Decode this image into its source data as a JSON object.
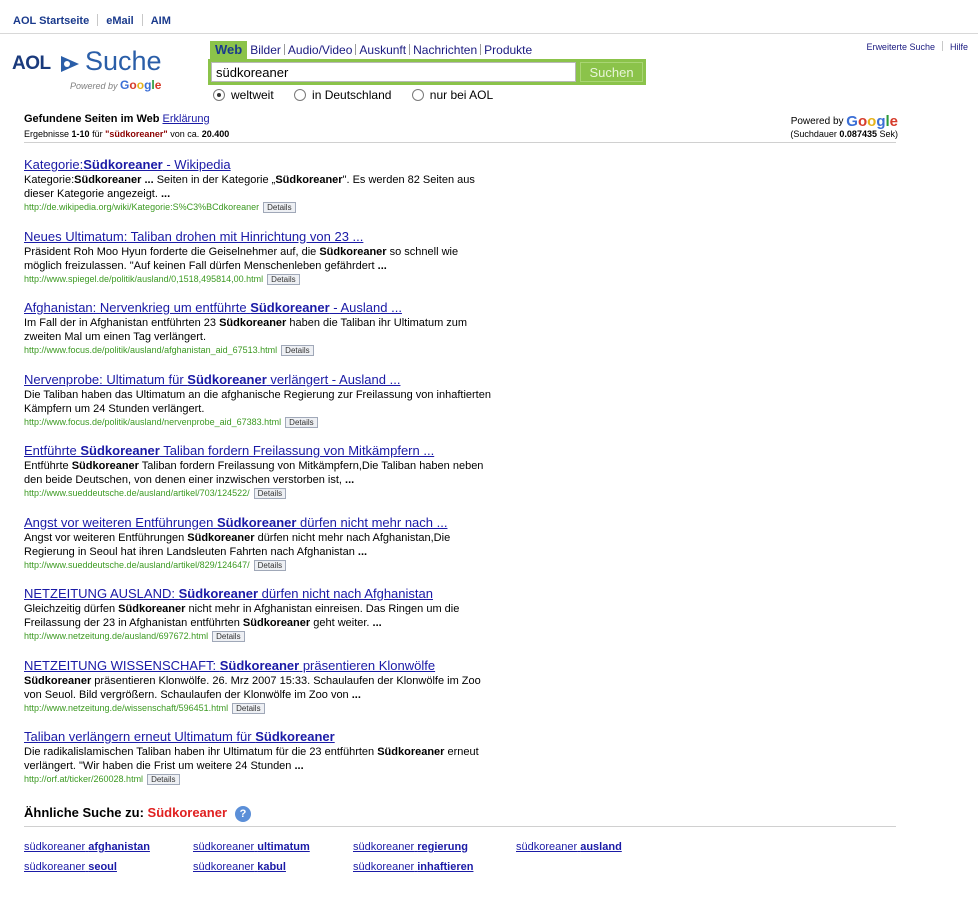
{
  "topnav": {
    "home": "AOL Startseite",
    "email": "eMail",
    "aim": "AIM"
  },
  "logo": {
    "aol": "AOL",
    "suche": "Suche",
    "powered": "Powered by",
    "google": "Google"
  },
  "tabs": [
    "Web",
    "Bilder",
    "Audio/Video",
    "Auskunft",
    "Nachrichten",
    "Produkte"
  ],
  "search": {
    "query": "südkoreaner",
    "button": "Suchen"
  },
  "scope": [
    "weltweit",
    "in Deutschland",
    "nur bei AOL"
  ],
  "toplinks": {
    "advanced": "Erweiterte Suche",
    "help": "Hilfe"
  },
  "summary": {
    "found": "Gefundene Seiten im Web",
    "explain": "Erklärung",
    "results_prefix": "Ergebnisse",
    "range": "1-10",
    "for": "für",
    "term": "\"südkoreaner\"",
    "about": "von ca.",
    "total": "20.400",
    "powered": "Powered by",
    "google": "Google",
    "duration_prefix": "(Suchdauer",
    "duration": "0.087435",
    "duration_suffix": "Sek)"
  },
  "details_label": "Details",
  "results": [
    {
      "title": [
        [
          "Kategorie:",
          false
        ],
        [
          "Südkoreaner",
          true
        ],
        [
          " - Wikipedia",
          false
        ]
      ],
      "snippet": [
        [
          "Kategorie:",
          false
        ],
        [
          "Südkoreaner ...",
          true
        ],
        [
          " Seiten in der Kategorie „",
          false
        ],
        [
          "Südkoreaner",
          true
        ],
        [
          "\". Es werden 82 Seiten aus dieser Kategorie angezeigt. ",
          false
        ],
        [
          "...",
          true
        ]
      ],
      "url": "http://de.wikipedia.org/wiki/Kategorie:S%C3%BCdkoreaner"
    },
    {
      "title": [
        [
          "Neues Ultimatum: Taliban drohen mit Hinrichtung von 23 ...",
          false
        ]
      ],
      "snippet": [
        [
          "Präsident Roh Moo Hyun forderte die Geiselnehmer auf, die ",
          false
        ],
        [
          "Südkoreaner",
          true
        ],
        [
          " so schnell wie möglich freizulassen. \"Auf keinen Fall dürfen Menschenleben gefährdert ",
          false
        ],
        [
          "...",
          true
        ]
      ],
      "url": "http://www.spiegel.de/politik/ausland/0,1518,495814,00.html"
    },
    {
      "title": [
        [
          "Afghanistan: Nervenkrieg um entführte ",
          false
        ],
        [
          "Südkoreaner",
          true
        ],
        [
          " - Ausland ...",
          false
        ]
      ],
      "snippet": [
        [
          "Im Fall der in Afghanistan entführten 23 ",
          false
        ],
        [
          "Südkoreaner",
          true
        ],
        [
          " haben die Taliban ihr Ultimatum zum zweiten Mal um einen Tag verlängert.",
          false
        ]
      ],
      "url": "http://www.focus.de/politik/ausland/afghanistan_aid_67513.html"
    },
    {
      "title": [
        [
          "Nervenprobe: Ultimatum für ",
          false
        ],
        [
          "Südkoreaner",
          true
        ],
        [
          " verlängert - Ausland ...",
          false
        ]
      ],
      "snippet": [
        [
          "Die Taliban haben das Ultimatum an die afghanische Regierung zur Freilassung von inhaftierten Kämpfern um 24 Stunden verlängert.",
          false
        ]
      ],
      "url": "http://www.focus.de/politik/ausland/nervenprobe_aid_67383.html"
    },
    {
      "title": [
        [
          "Entführte ",
          false
        ],
        [
          "Südkoreaner",
          true
        ],
        [
          " Taliban fordern Freilassung von Mitkämpfern ...",
          false
        ]
      ],
      "snippet": [
        [
          "Entführte ",
          false
        ],
        [
          "Südkoreaner",
          true
        ],
        [
          " Taliban fordern Freilassung von Mitkämpfern,Die Taliban haben neben den beide Deutschen, von denen einer inzwischen verstorben ist, ",
          false
        ],
        [
          "...",
          true
        ]
      ],
      "url": "http://www.sueddeutsche.de/ausland/artikel/703/124522/"
    },
    {
      "title": [
        [
          "Angst vor weiteren Entführungen ",
          false
        ],
        [
          "Südkoreaner",
          true
        ],
        [
          " dürfen nicht mehr nach ...",
          false
        ]
      ],
      "snippet": [
        [
          "Angst vor weiteren Entführungen ",
          false
        ],
        [
          "Südkoreaner",
          true
        ],
        [
          " dürfen nicht mehr nach Afghanistan,Die Regierung in Seoul hat ihren Landsleuten Fahrten nach Afghanistan ",
          false
        ],
        [
          "...",
          true
        ]
      ],
      "url": "http://www.sueddeutsche.de/ausland/artikel/829/124647/"
    },
    {
      "title": [
        [
          "NETZEITUNG AUSLAND: ",
          false
        ],
        [
          "Südkoreaner",
          true
        ],
        [
          " dürfen nicht nach Afghanistan",
          false
        ]
      ],
      "snippet": [
        [
          "Gleichzeitig dürfen ",
          false
        ],
        [
          "Südkoreaner",
          true
        ],
        [
          " nicht mehr in Afghanistan einreisen. Das Ringen um die Freilassung der 23 in Afghanistan entführten ",
          false
        ],
        [
          "Südkoreaner",
          true
        ],
        [
          " geht weiter. ",
          false
        ],
        [
          "...",
          true
        ]
      ],
      "url": "http://www.netzeitung.de/ausland/697672.html"
    },
    {
      "title": [
        [
          "NETZEITUNG WISSENSCHAFT: ",
          false
        ],
        [
          "Südkoreaner",
          true
        ],
        [
          " präsentieren Klonwölfe",
          false
        ]
      ],
      "snippet": [
        [
          "Südkoreaner",
          true
        ],
        [
          " präsentieren Klonwölfe. 26. Mrz 2007 15:33. Schaulaufen der Klonwölfe im Zoo von Seuol. Bild vergrößern. Schaulaufen der Klonwölfe im Zoo von ",
          false
        ],
        [
          "...",
          true
        ]
      ],
      "url": "http://www.netzeitung.de/wissenschaft/596451.html"
    },
    {
      "title": [
        [
          "Taliban verlängern erneut Ultimatum für ",
          false
        ],
        [
          "Südkoreaner",
          true
        ]
      ],
      "snippet": [
        [
          "Die radikalislamischen Taliban haben ihr Ultimatum für die 23 entführten ",
          false
        ],
        [
          "Südkoreaner",
          true
        ],
        [
          " erneut verlängert. \"Wir haben die Frist um weitere 24 Stunden ",
          false
        ],
        [
          "...",
          true
        ]
      ],
      "url": "http://orf.at/ticker/260028.html"
    }
  ],
  "similar": {
    "label": "Ähnliche Suche zu:",
    "term": "Südkoreaner",
    "help_icon": "question-icon",
    "items": [
      {
        "base": "südkoreaner",
        "extra": "afghanistan"
      },
      {
        "base": "südkoreaner",
        "extra": "ultimatum"
      },
      {
        "base": "südkoreaner",
        "extra": "regierung"
      },
      {
        "base": "südkoreaner",
        "extra": "ausland"
      },
      {
        "base": "südkoreaner",
        "extra": "seoul"
      },
      {
        "base": "südkoreaner",
        "extra": "kabul"
      },
      {
        "base": "südkoreaner",
        "extra": "inhaftieren"
      }
    ]
  },
  "colors": {
    "accent_green": "#8bc34a",
    "link": "#1a1aa6",
    "url_green": "#3c9a22",
    "term_red": "#e02020"
  }
}
